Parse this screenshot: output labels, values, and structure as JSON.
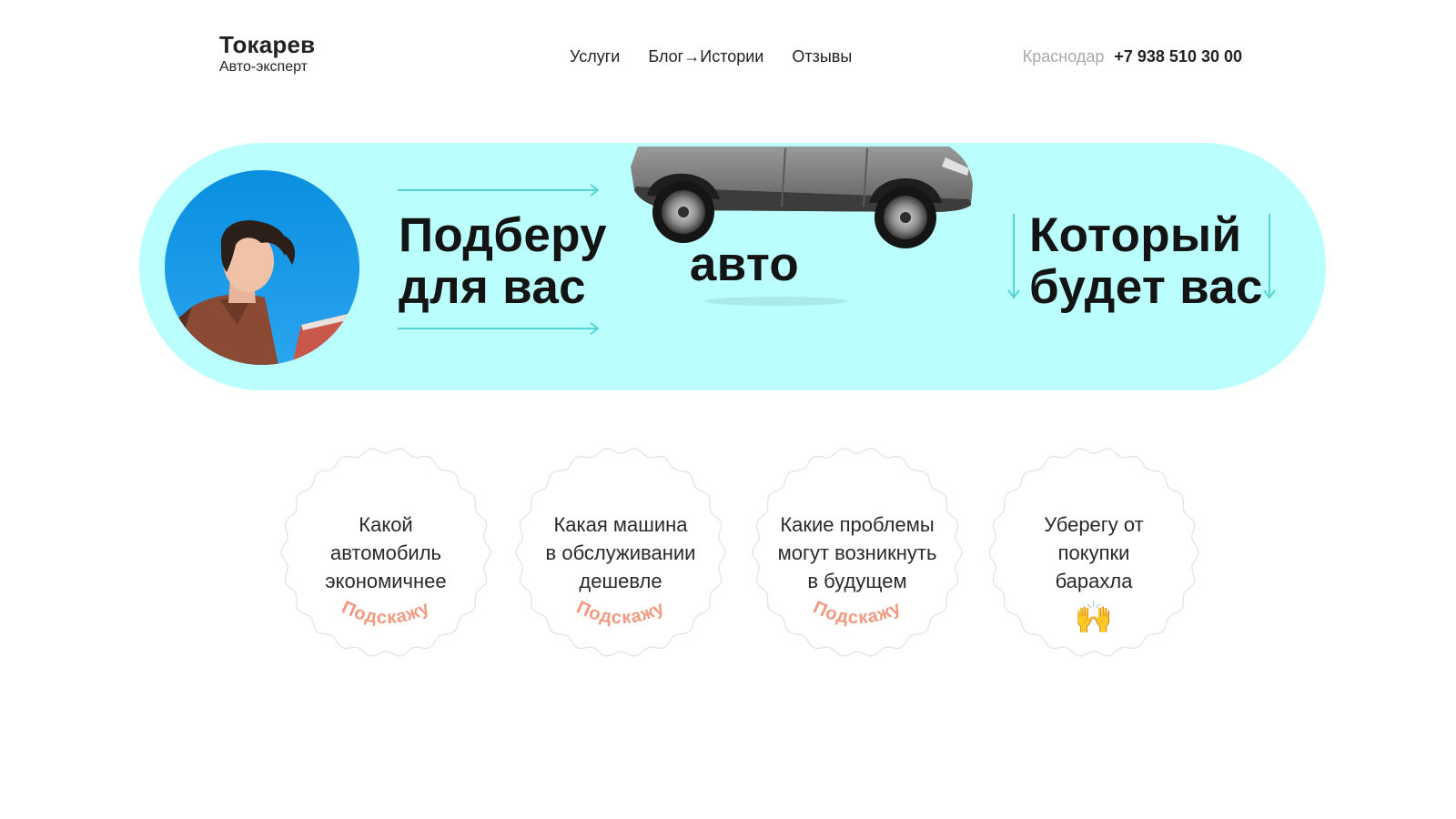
{
  "header": {
    "logo_title": "Токарев",
    "logo_subtitle": "Авто-эксперт",
    "nav": [
      {
        "label": "Услуги"
      },
      {
        "label": "Блог→Истории"
      },
      {
        "label": "Отзывы"
      }
    ],
    "city": "Краснодар",
    "phone": "+7 938 510 30 00"
  },
  "hero": {
    "left_line1": "Подберу",
    "left_line2": "для вас",
    "middle": "авто",
    "right_line1": "Который",
    "right_line2": "будет вас"
  },
  "features": [
    {
      "line1": "Какой",
      "line2": "автомобиль",
      "line3": "экономичнее",
      "cta": "Подскажу"
    },
    {
      "line1": "Какая машина",
      "line2": "в обслуживании",
      "line3": "дешевле",
      "cta": "Подскажу"
    },
    {
      "line1": "Какие проблемы",
      "line2": "могут возникнуть",
      "line3": "в будущем",
      "cta": "Подскажу"
    },
    {
      "line1": "Уберегу от",
      "line2": "покупки",
      "line3": "барахла",
      "emoji": "🙌"
    }
  ],
  "colors": {
    "hero_bg": "#bafefe",
    "accent_arrow": "#57d3d3",
    "cta": "#f19a80",
    "muted": "#a9a9a9"
  }
}
